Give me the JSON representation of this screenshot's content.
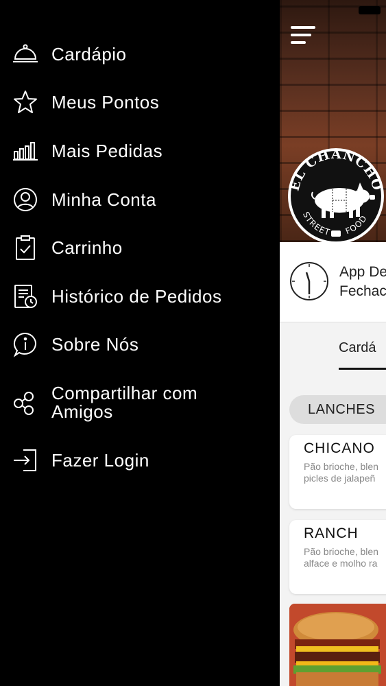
{
  "drawer": {
    "items": [
      {
        "label": "Cardápio",
        "icon": "cloche-icon"
      },
      {
        "label": "Meus Pontos",
        "icon": "star-icon"
      },
      {
        "label": "Mais Pedidas",
        "icon": "bar-chart-icon"
      },
      {
        "label": "Minha Conta",
        "icon": "user-circle-icon"
      },
      {
        "label": "Carrinho",
        "icon": "clipboard-check-icon"
      },
      {
        "label": "Histórico de Pedidos",
        "icon": "order-history-icon"
      },
      {
        "label": "Sobre Nós",
        "icon": "info-icon"
      },
      {
        "label": "Compartilhar com\nAmigos",
        "icon": "share-icon"
      },
      {
        "label": "Fazer Login",
        "icon": "login-icon"
      }
    ]
  },
  "content": {
    "logo_text": {
      "top": "EL CHANCHO",
      "bottom_left": "STREET",
      "bottom_right": "FOOD"
    },
    "info": {
      "line1": "App De",
      "line2": "Fechac"
    },
    "tab_label": "Cardá",
    "category_chip": "LANCHES",
    "products": [
      {
        "name": "CHICANO",
        "desc": "Pão brioche, blen\npicles de jalapeñ"
      },
      {
        "name": "RANCH",
        "desc": "Pão brioche, blen\nalface e molho ra"
      }
    ]
  },
  "colors": {
    "drawer_bg": "#000000",
    "text_light": "#ffffff",
    "chip_bg": "#dddddd"
  }
}
